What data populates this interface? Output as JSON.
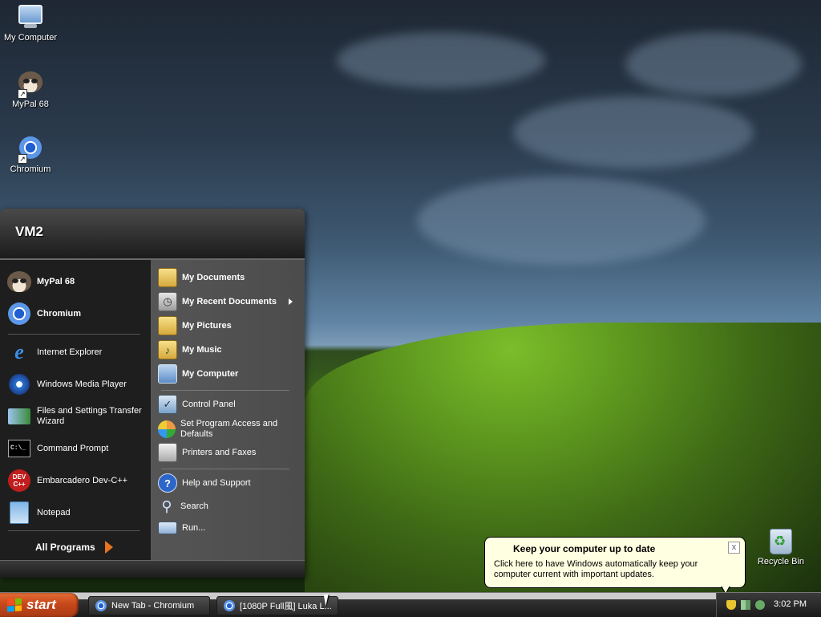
{
  "desktop": {
    "icons": [
      {
        "label": "My Computer",
        "icon": "my-computer-icon"
      },
      {
        "label": "MyPal 68",
        "icon": "mypal-icon"
      },
      {
        "label": "Chromium",
        "icon": "chromium-icon"
      },
      {
        "label": "Recycle Bin",
        "icon": "recycle-bin-icon"
      }
    ]
  },
  "start_menu": {
    "user": "VM2",
    "pinned": [
      {
        "label": "MyPal 68",
        "icon": "mypal-icon"
      },
      {
        "label": "Chromium",
        "icon": "chromium-icon"
      }
    ],
    "recent": [
      {
        "label": "Internet Explorer",
        "icon": "internet-explorer-icon"
      },
      {
        "label": "Windows Media Player",
        "icon": "media-player-icon"
      },
      {
        "label": "Files and Settings Transfer Wizard",
        "icon": "transfer-wizard-icon"
      },
      {
        "label": "Command Prompt",
        "icon": "command-prompt-icon"
      },
      {
        "label": "Embarcadero Dev-C++",
        "icon": "devcpp-icon"
      },
      {
        "label": "Notepad",
        "icon": "notepad-icon"
      }
    ],
    "all_programs": "All Programs",
    "places": [
      {
        "label": "My Documents",
        "icon": "folder-icon"
      },
      {
        "label": "My Recent Documents",
        "icon": "recent-documents-icon"
      },
      {
        "label": "My Pictures",
        "icon": "folder-pictures-icon"
      },
      {
        "label": "My Music",
        "icon": "folder-music-icon"
      },
      {
        "label": "My Computer",
        "icon": "my-computer-icon"
      }
    ],
    "system": [
      {
        "label": "Control Panel",
        "icon": "control-panel-icon"
      },
      {
        "label": "Set Program Access and Defaults",
        "icon": "program-defaults-icon"
      },
      {
        "label": "Printers and Faxes",
        "icon": "printer-icon"
      }
    ],
    "help": [
      {
        "label": "Help and Support",
        "icon": "help-icon"
      },
      {
        "label": "Search",
        "icon": "search-icon"
      },
      {
        "label": "Run...",
        "icon": "run-icon"
      }
    ]
  },
  "taskbar": {
    "start_label": "start",
    "tasks": [
      {
        "label": "New Tab - Chromium",
        "icon": "chromium-icon"
      },
      {
        "label": "[1080P Full風] Luka L...",
        "icon": "chromium-icon"
      }
    ],
    "clock": "3:02 PM"
  },
  "balloon": {
    "title": "Keep your computer up to date",
    "body": "Click here to have Windows automatically keep your computer current with important updates.",
    "close": "x"
  },
  "colors": {
    "start_button": "#c8481b",
    "taskbar": "#2a2a2a",
    "balloon_bg": "#ffffe1"
  }
}
